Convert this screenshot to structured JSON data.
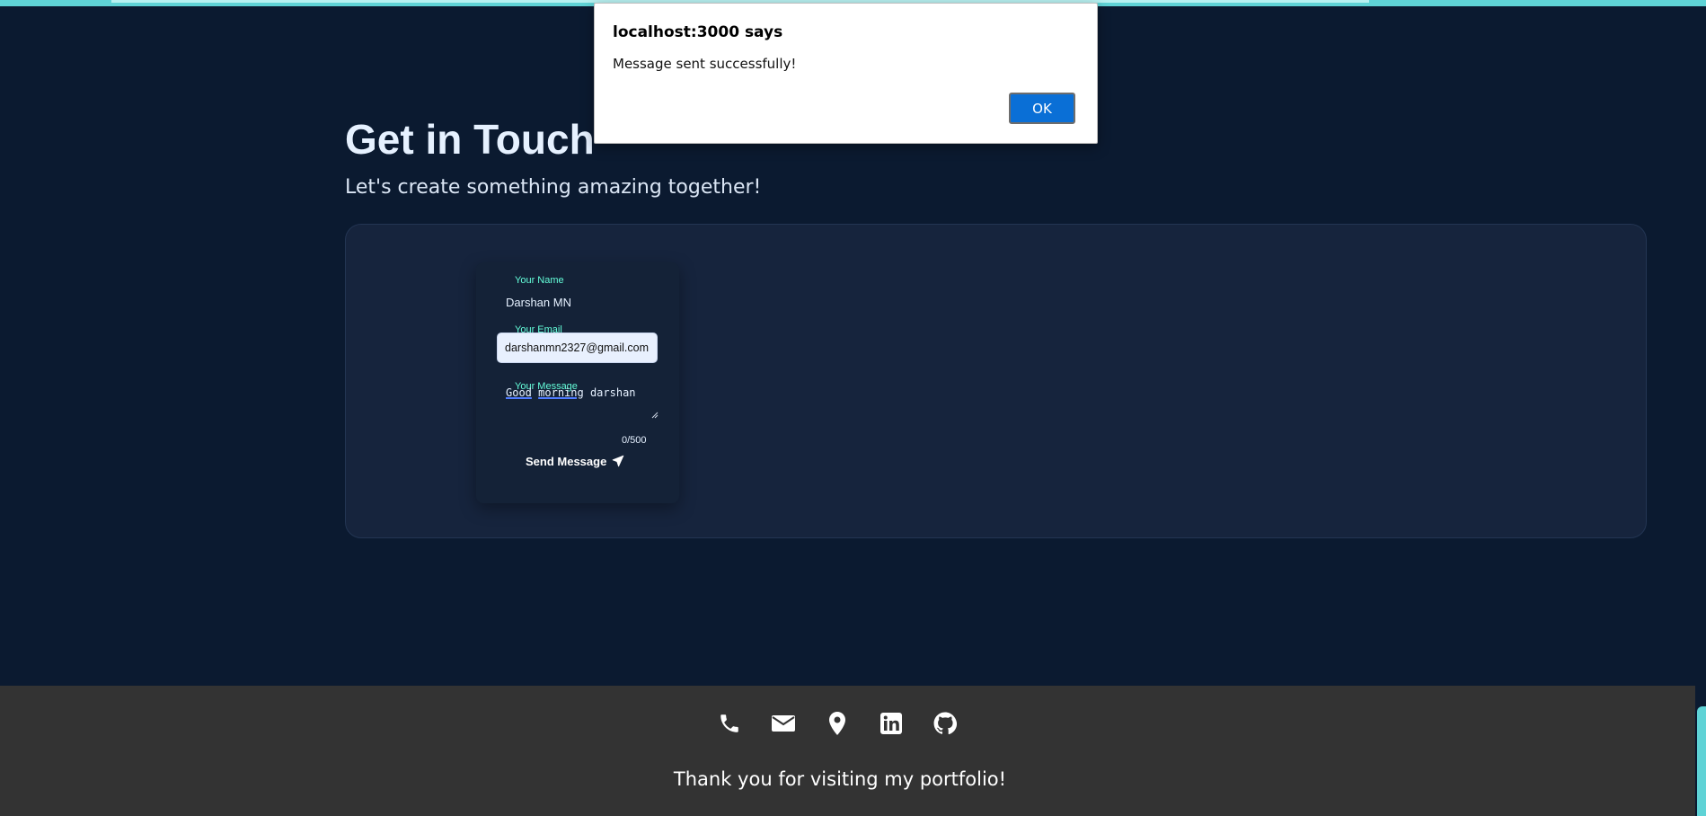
{
  "dialog": {
    "title": "localhost:3000 says",
    "message": "Message sent successfully!",
    "ok_label": "OK"
  },
  "contact": {
    "title": "Get in Touch",
    "subtitle": "Let's create something amazing together!",
    "form": {
      "name_label": "Your Name",
      "name_value": "Darshan MN",
      "email_label": "Your Email",
      "email_value": "darshanmn2327@gmail.com",
      "message_label": "Your Message",
      "message_words": [
        "Good",
        "morning",
        "darshan"
      ],
      "char_count": "0/500",
      "send_label": "Send Message"
    }
  },
  "footer": {
    "icons": [
      "phone-icon",
      "email-icon",
      "location-icon",
      "linkedin-icon",
      "github-icon"
    ],
    "thanks_text": "Thank you for visiting my portfolio!"
  },
  "colors": {
    "background": "#0b1a30",
    "card": "#16243d",
    "accent": "#64ffda",
    "footer": "#333333",
    "dialog_button": "#0a6fd6"
  }
}
